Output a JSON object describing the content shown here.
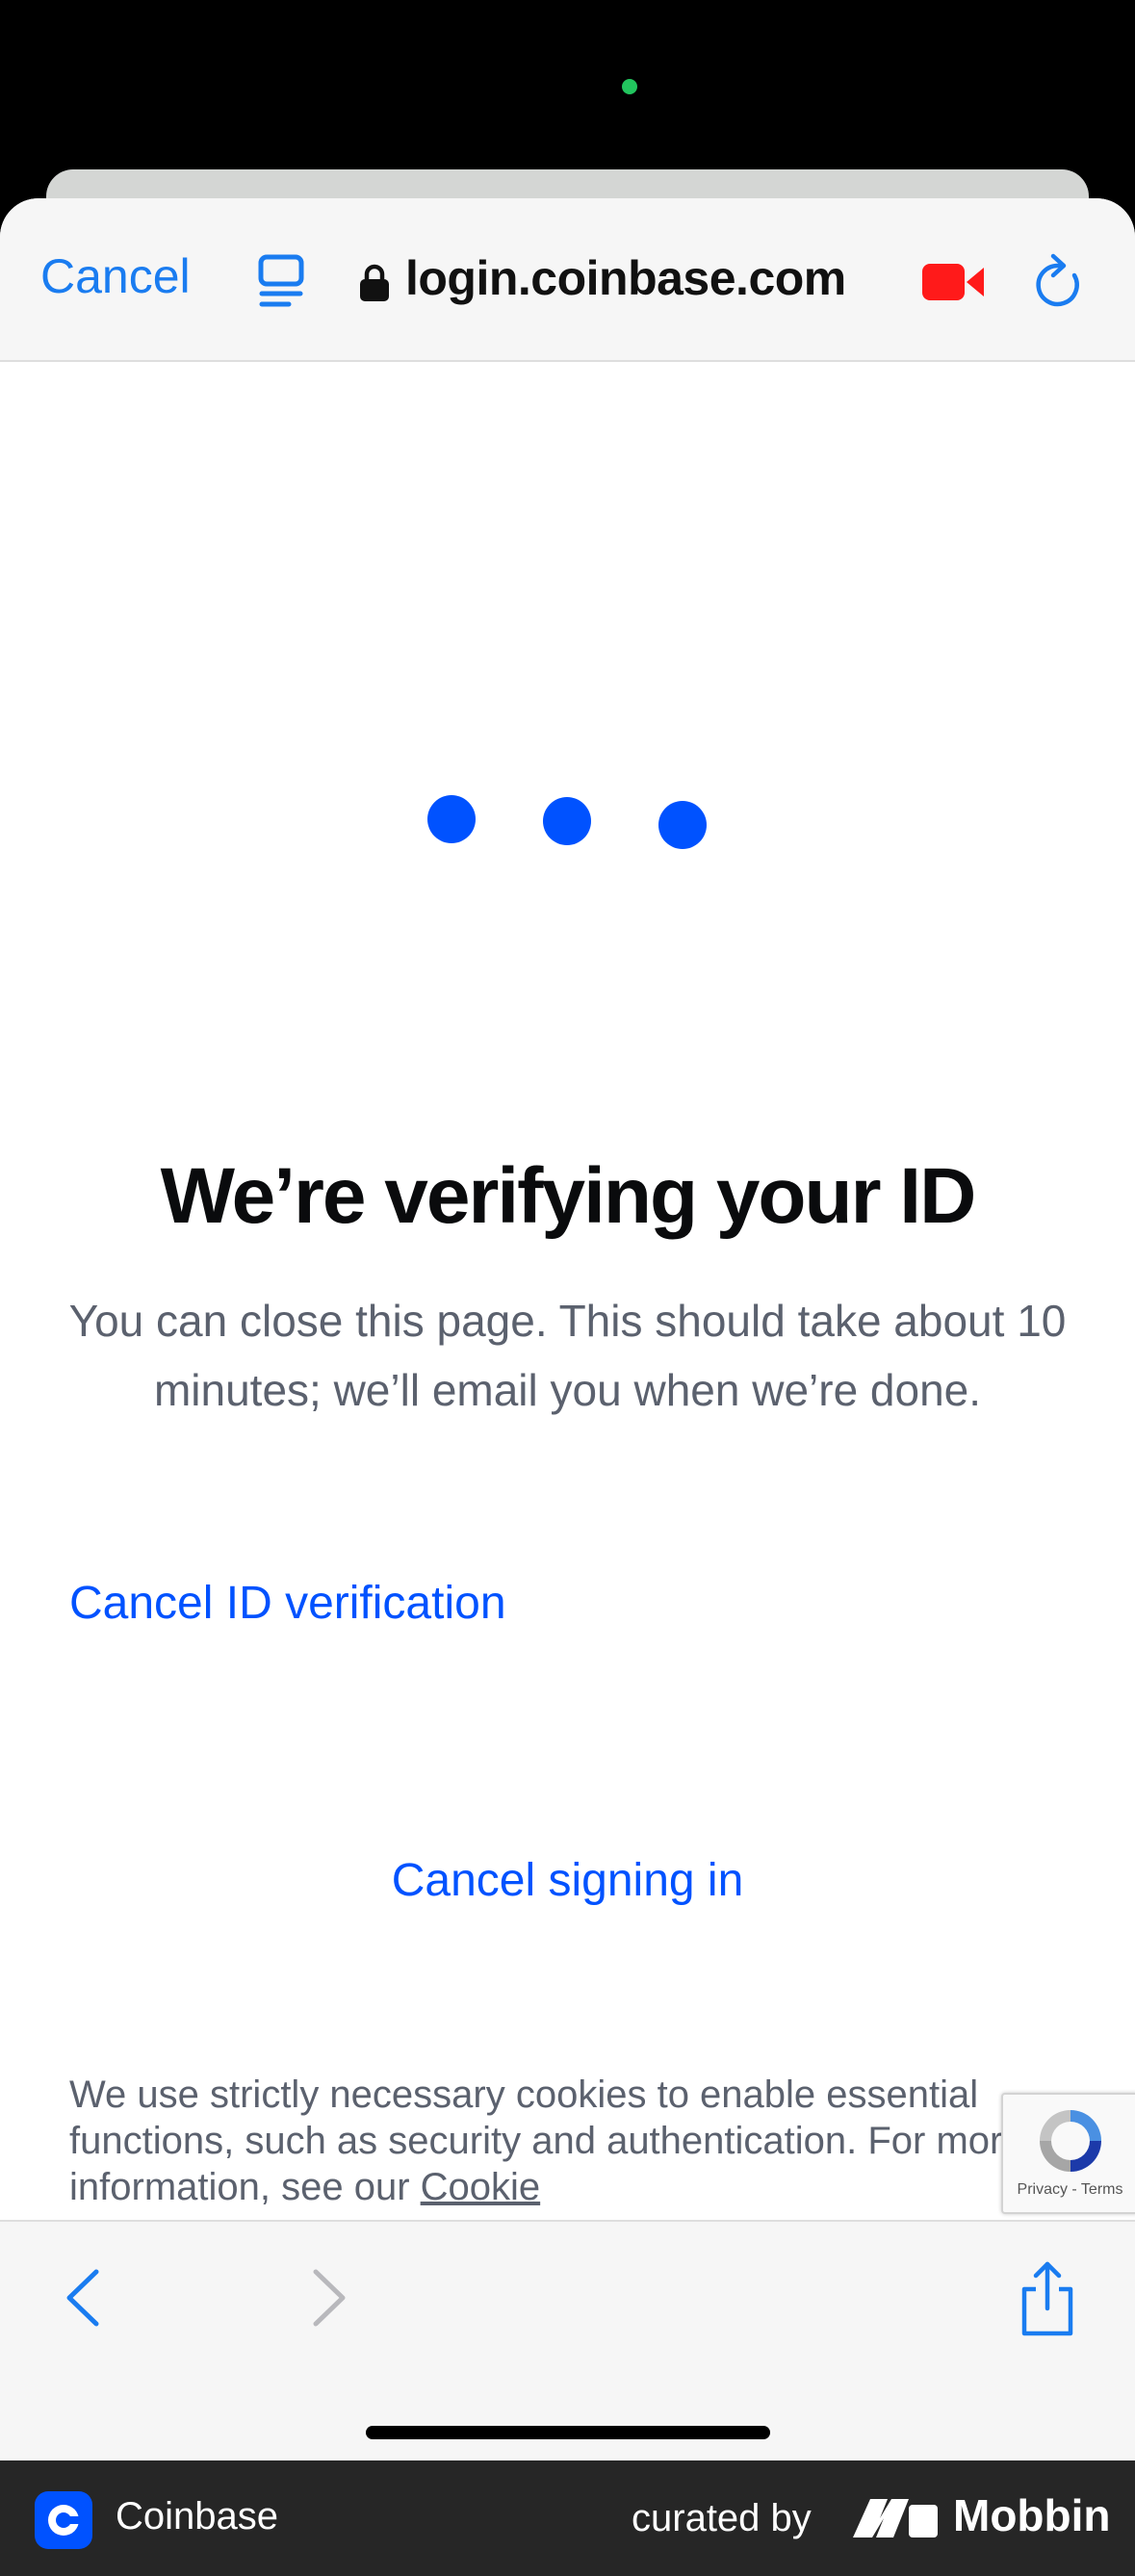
{
  "browser": {
    "cancel_label": "Cancel",
    "url": "login.coinbase.com",
    "icons": {
      "reader": "reader-icon",
      "lock": "lock-icon",
      "camera": "video-camera-icon",
      "reload": "reload-icon"
    }
  },
  "page": {
    "headline": "We’re verifying your ID",
    "subtext": "You can close this page. This should take about 10 minutes; we’ll email you when we’re done.",
    "cancel_id_verification": "Cancel ID verification",
    "cancel_signing_in": "Cancel signing in",
    "cookie_text": "We use strictly necessary cookies to enable essential functions, such as security and authentication. For more information, see our ",
    "cookie_link": "Cookie",
    "recaptcha_terms": "Privacy - Terms"
  },
  "toolbar": {
    "icons": [
      "chevron-left-icon",
      "chevron-right-icon",
      "share-icon"
    ]
  },
  "footer": {
    "app_name": "Coinbase",
    "curated_by": "curated by",
    "brand": "Mobbin"
  },
  "colors": {
    "accent": "#0052ff",
    "ios_blue": "#1a7cf0",
    "recording_red": "#ff1a1a"
  }
}
